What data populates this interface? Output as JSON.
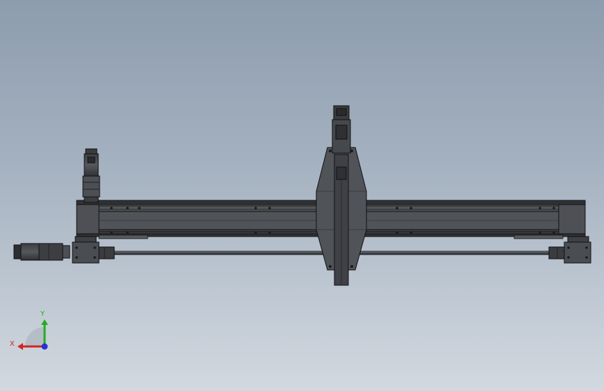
{
  "view": {
    "background_top": "#8d9cae",
    "background_bottom": "#d2d8df",
    "part_color": "#4a4c50",
    "edge_color": "#111111"
  },
  "triad": {
    "x_label": "X",
    "y_label": "Y",
    "x_color": "#d42424",
    "y_color": "#1fae1f",
    "z_color": "#2433d8"
  }
}
